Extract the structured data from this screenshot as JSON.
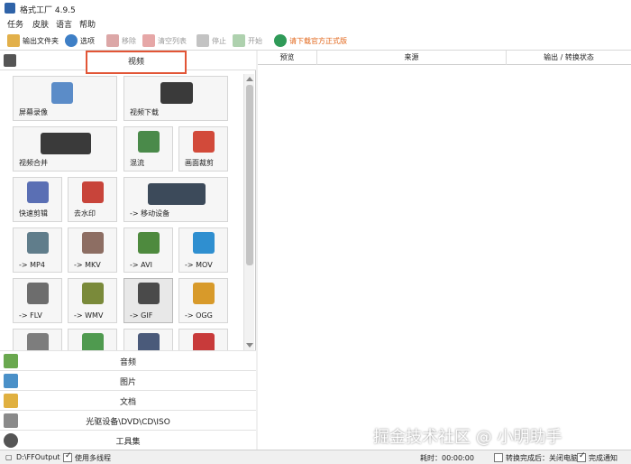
{
  "window": {
    "title": "格式工厂 4.9.5"
  },
  "menu": [
    "任务",
    "皮肤",
    "语言",
    "帮助"
  ],
  "toolbar": {
    "output_folder": "输出文件夹",
    "options": "选项",
    "remove": "移除",
    "clear_list": "清空列表",
    "stop": "停止",
    "start": "开始",
    "download_official": "请下载官方正式版"
  },
  "left_panel": {
    "video_header": "视频",
    "tiles": [
      {
        "label": "屏幕录像",
        "icon": "screen-record-icon"
      },
      {
        "label": "视频下载",
        "icon": "video-download-icon"
      },
      {
        "label": "视频合并",
        "icon": "video-merge-icon"
      },
      {
        "label": "混流",
        "icon": "mux-icon"
      },
      {
        "label": "画面裁剪",
        "icon": "crop-icon"
      },
      {
        "label": "快速剪辑",
        "icon": "quick-clip-icon"
      },
      {
        "label": "去水印",
        "icon": "remove-watermark-icon"
      },
      {
        "label": "-> 移动设备",
        "icon": "mobile-device-icon"
      },
      {
        "label": "-> MP4",
        "icon": "mp4-file-icon"
      },
      {
        "label": "-> MKV",
        "icon": "mkv-file-icon"
      },
      {
        "label": "-> AVI",
        "icon": "avi-file-icon"
      },
      {
        "label": "-> MOV",
        "icon": "mov-file-icon"
      },
      {
        "label": "-> FLV",
        "icon": "flv-file-icon"
      },
      {
        "label": "-> WMV",
        "icon": "wmv-file-icon"
      },
      {
        "label": "-> GIF",
        "icon": "gif-file-icon"
      },
      {
        "label": "-> OGG",
        "icon": "ogg-file-icon"
      }
    ],
    "categories": [
      {
        "label": "音频",
        "icon": "audio-icon"
      },
      {
        "label": "图片",
        "icon": "image-icon"
      },
      {
        "label": "文档",
        "icon": "document-icon"
      },
      {
        "label": "光驱设备\\DVD\\CD\\ISO",
        "icon": "disc-icon"
      },
      {
        "label": "工具集",
        "icon": "tools-icon"
      }
    ]
  },
  "task_list": {
    "columns": [
      "预览",
      "来源",
      "输出 / 转换状态"
    ]
  },
  "statusbar": {
    "output_path": "D:\\FFOutput",
    "multithread": "使用多线程",
    "elapsed": "耗时：00:00:00",
    "after_convert": "转换完成后：关闭电脑",
    "notify": "完成通知"
  },
  "watermark": "掘金技术社区 @ 小明助手",
  "colors": {
    "accent": "#e25536",
    "link": "#e2661a"
  }
}
